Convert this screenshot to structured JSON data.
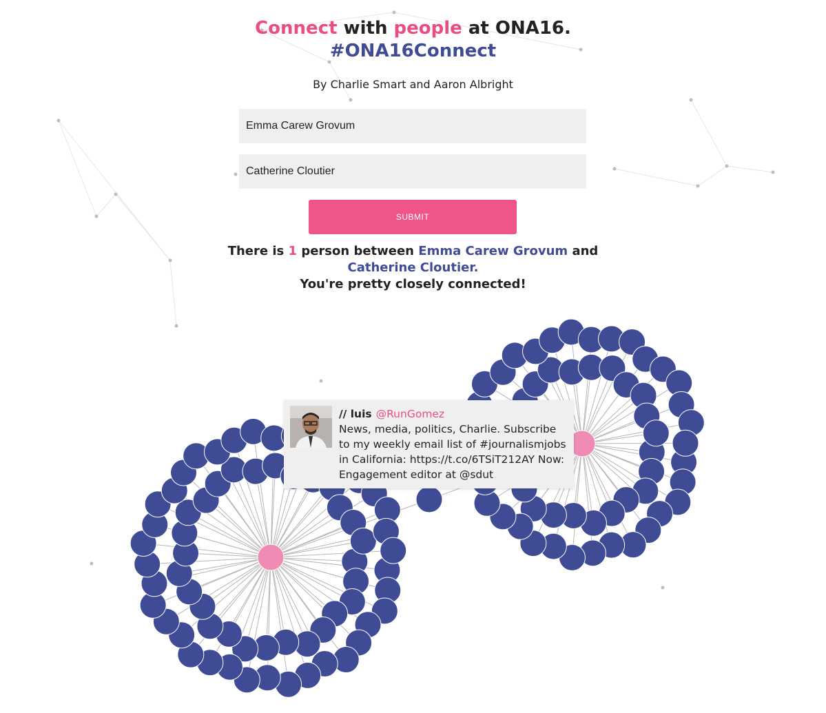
{
  "header": {
    "title_word1": "Connect",
    "title_with": " with ",
    "title_word2": "people",
    "title_rest": " at ONA16.",
    "hashtag": "#ONA16Connect",
    "byline": "By Charlie Smart and Aaron Albright"
  },
  "form": {
    "person_a_value": "Emma Carew Grovum",
    "person_b_value": "Catherine Cloutier",
    "submit_label": "SUBMIT"
  },
  "result": {
    "prefix": "There is ",
    "count": "1",
    "middle": " person between ",
    "person_a": "Emma Carew Grovum",
    "and": " and ",
    "person_b": "Catherine Cloutier.",
    "conclusion": "You're pretty closely connected!"
  },
  "tooltip": {
    "name": "// luis",
    "handle": "@RunGomez",
    "bio": "News, media, politics, Charlie. Subscribe to my weekly email list of #journalismjobs in California: https://t.co/6TSiT212AY Now: Engagement editor at @sdut"
  },
  "colors": {
    "accent_pink": "#ea4d86",
    "navy": "#3f4b95",
    "node_pink": "#f08bb5",
    "submit_bg": "#ef5586"
  }
}
